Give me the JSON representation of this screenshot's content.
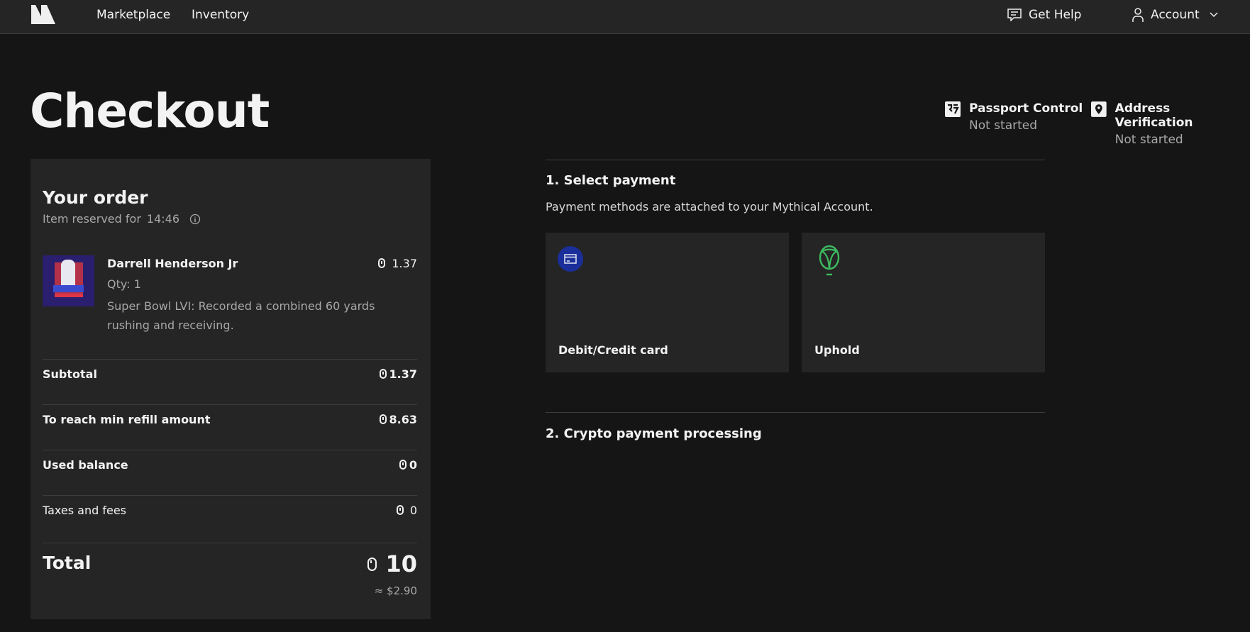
{
  "nav": {
    "links": [
      "Marketplace",
      "Inventory"
    ],
    "help": "Get Help",
    "account": "Account"
  },
  "page": {
    "title": "Checkout"
  },
  "verification": [
    {
      "label": "Passport Control",
      "status": "Not started"
    },
    {
      "label": "Address Verification",
      "status": "Not started"
    }
  ],
  "order": {
    "title": "Your order",
    "reserved_label": "Item reserved for",
    "timer": "14:46",
    "item": {
      "name": "Darrell Henderson Jr",
      "price": "1.37",
      "qty": "Qty: 1",
      "description": "Super Bowl LVI: Recorded a combined 60 yards rushing and receiving."
    },
    "lines": [
      {
        "label": "Subtotal",
        "value": "1.37"
      },
      {
        "label": "To reach min refill amount",
        "value": "8.63"
      },
      {
        "label": "Used balance",
        "value": "0"
      },
      {
        "label": "Taxes and fees",
        "value": "0"
      }
    ],
    "total": {
      "label": "Total",
      "value": "10",
      "usd": "≈ $2.90"
    }
  },
  "payment": {
    "step1": "1. Select payment",
    "subtitle": "Payment methods are attached to your Mythical Account.",
    "methods": [
      {
        "label": "Debit/Credit card",
        "icon": "credit-card-icon",
        "color": "#1a2f9a"
      },
      {
        "label": "Uphold",
        "icon": "uphold-icon",
        "color": "#3dbb5f"
      }
    ],
    "step2": "2. Crypto payment processing"
  }
}
